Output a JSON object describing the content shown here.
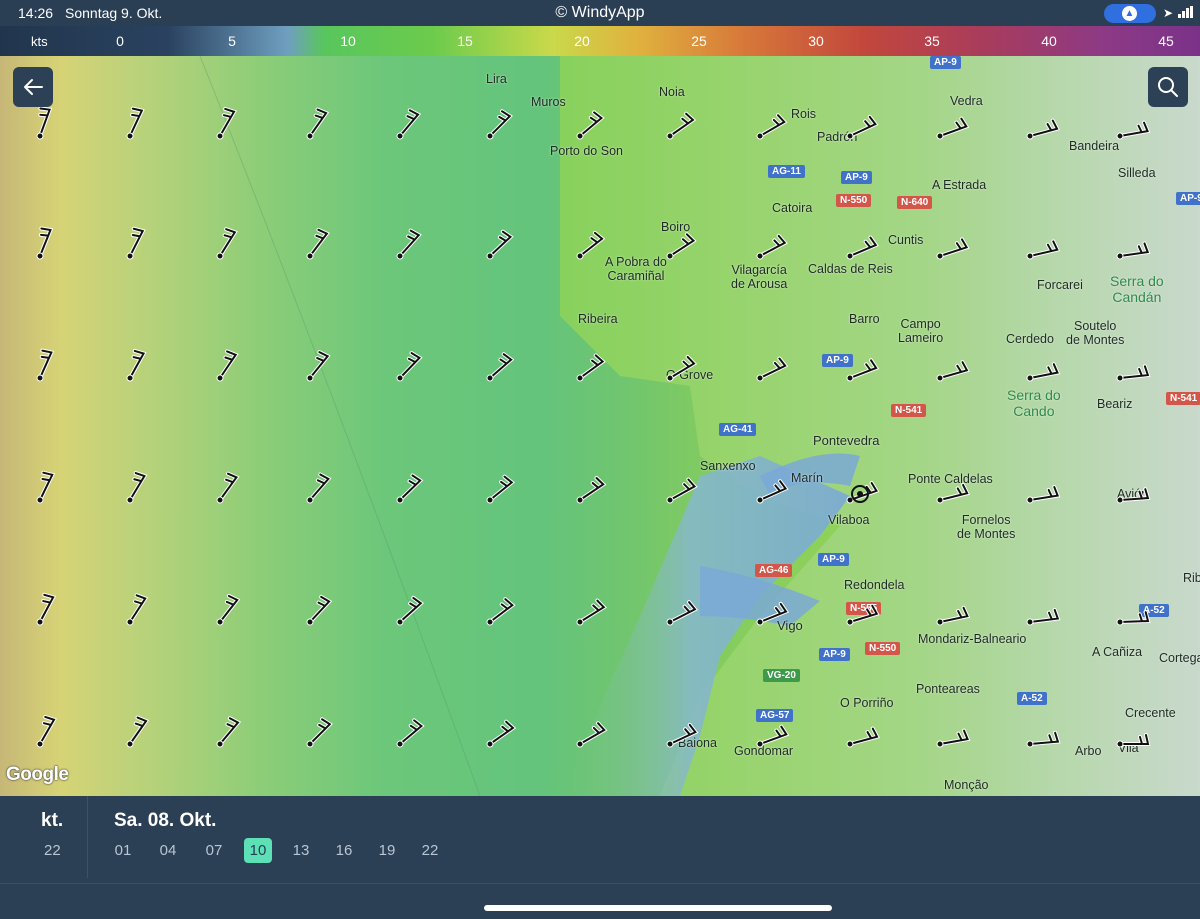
{
  "status": {
    "time": "14:26",
    "date": "Sonntag 9. Okt.",
    "app_title": "© WindyApp",
    "nav_icon": "navigation-arrow-icon",
    "location_icon": "location-arrow-icon",
    "signal_icon": "cellular-signal-icon"
  },
  "scale": {
    "unit": "kts",
    "ticks": [
      "0",
      "5",
      "10",
      "15",
      "20",
      "25",
      "30",
      "35",
      "40",
      "45"
    ]
  },
  "map": {
    "towns": [
      {
        "label": "Lira"
      },
      {
        "label": "Muros"
      },
      {
        "label": "Noia"
      },
      {
        "label": "Rois"
      },
      {
        "label": "Padrón"
      },
      {
        "label": "Vedra"
      },
      {
        "label": "Porto do Son"
      },
      {
        "label": "Bandeira"
      },
      {
        "label": "Silleda"
      },
      {
        "label": "A Estrada"
      },
      {
        "label": "Catoira"
      },
      {
        "label": "Boiro"
      },
      {
        "label": "Cuntis"
      },
      {
        "label": "A Pobra do\nCaramiñal"
      },
      {
        "label": "Vilagarcía\nde Arousa"
      },
      {
        "label": "Caldas de Reis"
      },
      {
        "label": "Forcarei"
      },
      {
        "label": "Ribeira"
      },
      {
        "label": "Barro"
      },
      {
        "label": "Campo\nLameiro"
      },
      {
        "label": "Cerdedo"
      },
      {
        "label": "Soutelo\nde Montes"
      },
      {
        "label": "O Grove"
      },
      {
        "label": "Beariz"
      },
      {
        "label": "Pontevedra"
      },
      {
        "label": "Sanxenxo"
      },
      {
        "label": "Marín"
      },
      {
        "label": "Ponte Caldelas"
      },
      {
        "label": "Vilaboa"
      },
      {
        "label": "Fornelos\nde Montes"
      },
      {
        "label": "Avión"
      },
      {
        "label": "Redondela"
      },
      {
        "label": "Vigo"
      },
      {
        "label": "Mondariz-Balneario"
      },
      {
        "label": "A Cañiza"
      },
      {
        "label": "Cortegada"
      },
      {
        "label": "Ponteareas"
      },
      {
        "label": "O Porriño"
      },
      {
        "label": "Crecente"
      },
      {
        "label": "Baiona"
      },
      {
        "label": "Gondomar"
      },
      {
        "label": "Arbo"
      },
      {
        "label": "Vila"
      },
      {
        "label": "Monção"
      },
      {
        "label": "Ribadavia"
      }
    ],
    "regions": [
      {
        "label": "Serra do\nCandán"
      },
      {
        "label": "Serra do\nCando"
      }
    ],
    "roads": [
      {
        "label": "AG-11",
        "color": "blue"
      },
      {
        "label": "AP-9",
        "color": "blue"
      },
      {
        "label": "N-550",
        "color": "red"
      },
      {
        "label": "N-640",
        "color": "red"
      },
      {
        "label": "AP-9",
        "color": "blue"
      },
      {
        "label": "N-541",
        "color": "red"
      },
      {
        "label": "AG-41",
        "color": "blue"
      },
      {
        "label": "N-541",
        "color": "red"
      },
      {
        "label": "AP-9",
        "color": "blue"
      },
      {
        "label": "AG-46",
        "color": "red"
      },
      {
        "label": "N-555",
        "color": "red"
      },
      {
        "label": "A-52",
        "color": "blue"
      },
      {
        "label": "AP-9",
        "color": "blue"
      },
      {
        "label": "N-550",
        "color": "red"
      },
      {
        "label": "VG-20",
        "color": "green"
      },
      {
        "label": "A-52",
        "color": "blue"
      },
      {
        "label": "AG-57",
        "color": "blue"
      },
      {
        "label": "AP-9",
        "color": "blue"
      },
      {
        "label": "AP-9",
        "color": "blue"
      }
    ],
    "attribution": "Google"
  },
  "buttons": {
    "back_icon": "back-arrow-icon",
    "search_icon": "search-icon"
  },
  "timeline": {
    "prev_day": "kt.",
    "prev_hour": "22",
    "day": "Sa. 08. Okt.",
    "hours": [
      "01",
      "04",
      "07",
      "10",
      "13",
      "16",
      "19",
      "22"
    ],
    "selected_hour": "10"
  },
  "colors": {
    "bar_bg": "#2b3f55",
    "accent": "#5ee0b7",
    "road_blue": "#3f72c8",
    "road_red": "#d2574a"
  }
}
